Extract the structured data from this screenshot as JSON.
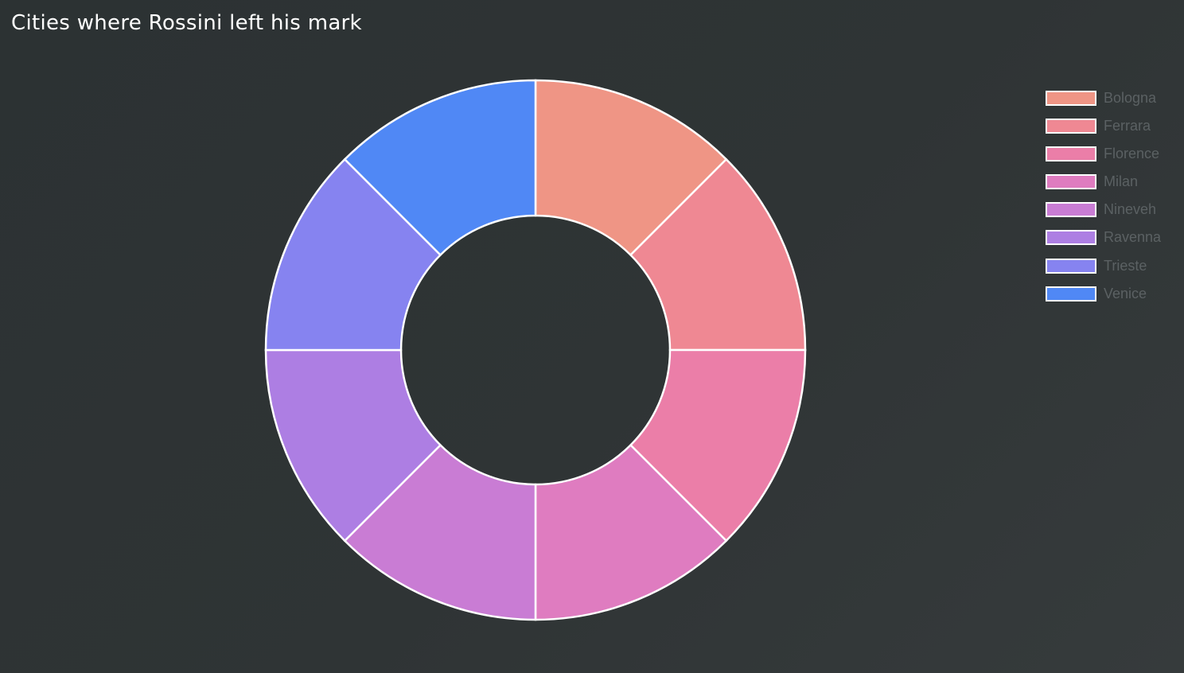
{
  "chart_data": {
    "type": "pie",
    "subtype": "doughnut",
    "title": "Cities where Rossini left his mark",
    "categories": [
      "Bologna",
      "Ferrara",
      "Florence",
      "Milan",
      "Nineveh",
      "Ravenna",
      "Trieste",
      "Venice"
    ],
    "values": [
      1,
      1,
      1,
      1,
      1,
      1,
      1,
      1
    ],
    "colors": [
      "#ef9585",
      "#ef8893",
      "#eb7ea8",
      "#df7cc0",
      "#c97cd4",
      "#ad7ee3",
      "#8683f0",
      "#5088f5"
    ],
    "legend_position": "top-right",
    "segment_border_color": "#ffffff"
  }
}
